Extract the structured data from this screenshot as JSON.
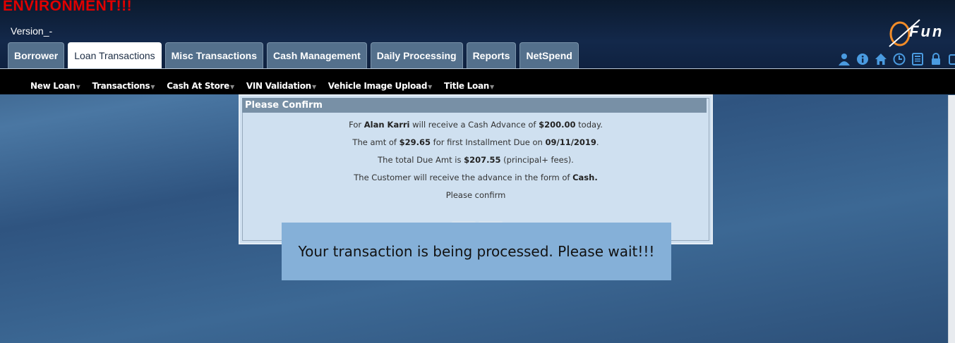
{
  "banner": {
    "environment": "ENVIRONMENT!!!",
    "version": "Version_-"
  },
  "logo": {
    "text": "Fun"
  },
  "tabs": [
    {
      "label": "Borrower",
      "active": false
    },
    {
      "label": "Loan Transactions",
      "active": true
    },
    {
      "label": "Misc Transactions",
      "active": false
    },
    {
      "label": "Cash Management",
      "active": false
    },
    {
      "label": "Daily Processing",
      "active": false
    },
    {
      "label": "Reports",
      "active": false
    },
    {
      "label": "NetSpend",
      "active": false
    }
  ],
  "toolbar_icons": [
    "user-icon",
    "info-icon",
    "home-icon",
    "clock-icon",
    "calculator-icon",
    "lock-icon",
    "window-icon"
  ],
  "subnav": [
    {
      "label": "New Loan"
    },
    {
      "label": "Transactions"
    },
    {
      "label": "Cash At Store"
    },
    {
      "label": "VIN Validation"
    },
    {
      "label": "Vehicle Image Upload"
    },
    {
      "label": "Title Loan"
    }
  ],
  "dialog": {
    "title": "Please Confirm",
    "line1": {
      "pre": "For ",
      "name": "Alan  Karri",
      "mid": "  will receive a Cash Advance of ",
      "amount": "$200.00",
      "post": " today."
    },
    "line2": {
      "pre": "The amt of ",
      "amount": "$29.65",
      "mid": " for first Installment Due on ",
      "date": "09/11/2019",
      "post": "."
    },
    "line3": {
      "pre": "The total Due Amt is ",
      "amount": "$207.55",
      "post": " (principal+ fees)."
    },
    "line4": {
      "pre": "The Customer will receive the advance in the form of ",
      "form": "Cash."
    },
    "line5": "Please confirm"
  },
  "overlay": {
    "message": "Your transaction is being processed. Please wait!!!"
  },
  "colors": {
    "env_red": "#e00000",
    "tab_bg": "#54708c",
    "dialog_bg": "#cfe0f0",
    "overlay_bg": "#85b0d8"
  }
}
